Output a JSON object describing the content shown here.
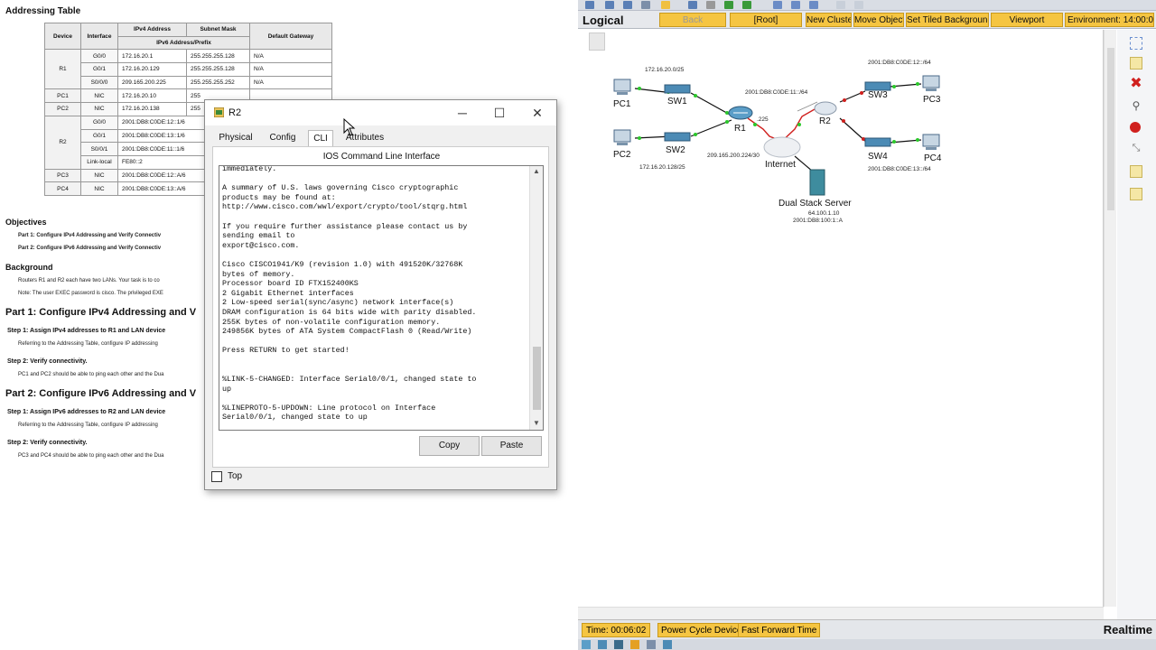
{
  "doc": {
    "title": "Addressing Table",
    "table": {
      "headers": [
        "Device",
        "Interface",
        "IPv4 Address",
        "Subnet Mask",
        "Default Gateway",
        "IPv6 Address/Prefix"
      ],
      "rows": [
        [
          "R1",
          "G0/0",
          "172.16.20.1",
          "255.255.255.128",
          "N/A"
        ],
        [
          "",
          "G0/1",
          "172.16.20.129",
          "255.255.255.128",
          "N/A"
        ],
        [
          "",
          "S0/0/0",
          "209.165.200.225",
          "255.255.255.252",
          "N/A"
        ],
        [
          "PC1",
          "NIC",
          "172.16.20.10",
          "255",
          ""
        ],
        [
          "PC2",
          "NIC",
          "172.16.20.138",
          "255",
          ""
        ],
        [
          "R2",
          "G0/0",
          "2001:DB8:C0DE:12::1/6",
          "",
          ""
        ],
        [
          "",
          "G0/1",
          "2001:DB8:C0DE:13::1/6",
          "",
          ""
        ],
        [
          "",
          "S0/0/1",
          "2001:DB8:C0DE:11::1/6",
          "",
          ""
        ],
        [
          "",
          "Link-local",
          "FE80::2",
          "",
          ""
        ],
        [
          "PC3",
          "NIC",
          "2001:DB8:C0DE:12::A/6",
          "",
          ""
        ],
        [
          "PC4",
          "NIC",
          "2001:DB8:C0DE:13::A/6",
          "",
          ""
        ]
      ]
    },
    "objectives": {
      "heading": "Objectives",
      "part1": "Part 1: Configure IPv4 Addressing and Verify Connectiv",
      "part2": "Part 2: Configure IPv6 Addressing and Verify Connectiv"
    },
    "background": {
      "heading": "Background",
      "line1": "Routers R1 and R2 each have two LANs. Your task is to co",
      "line2": "Note: The user EXEC password is cisco. The privileged EXE"
    },
    "part1": {
      "heading": "Part 1:  Configure IPv4 Addressing and V",
      "step1": "Step 1:  Assign IPv4 addresses to R1 and LAN device",
      "step1_text": "Referring to the Addressing Table, configure IP addressing",
      "step2": "Step 2:  Verify connectivity.",
      "step2_text": "PC1 and PC2 should be able to ping each other and the Dua"
    },
    "part2": {
      "heading": "Part 2:  Configure IPv6 Addressing and V",
      "step1": "Step 1:  Assign IPv6 addresses to R2 and LAN device",
      "step1_text": "Referring to the Addressing Table, configure IP addressing",
      "step2": "Step 2:  Verify connectivity.",
      "step2_text": "PC3 and PC4 should be able to ping each other and the Dua"
    }
  },
  "pt": {
    "mode": "Logical",
    "toolbar": {
      "back": "Back",
      "root": "[Root]",
      "new_cluster": "New Cluster",
      "move_object": "Move Object",
      "set_tiled_bg": "Set Tiled Background",
      "viewport": "Viewport",
      "environment": "Environment: 14:00:0"
    },
    "nodes": {
      "pc1": "PC1",
      "pc2": "PC2",
      "sw1": "SW1",
      "sw2": "SW2",
      "r1": "R1",
      "r2": "R2",
      "sw3": "SW3",
      "sw4": "SW4",
      "pc3": "PC3",
      "pc4": "PC4",
      "internet": "Internet",
      "server": "Dual Stack Server"
    },
    "addresses": {
      "lan1": "172.16.20.0/25",
      "lan2": "172.16.20.128/25",
      "wan": "209.165.200.224/30",
      "r1_if": ".225",
      "r2_wan": "2001:DB8:C0DE:11::/64",
      "lan3": "2001:DB8:C0DE:12::/64",
      "lan4": "2001:DB8:C0DE:13::/64",
      "server_v4": "64.100.1.10",
      "server_v6": "2001:DB8:100:1::A"
    },
    "status": {
      "time": "Time: 00:06:02",
      "power_cycle": "Power Cycle Devices",
      "fast_forward": "Fast Forward Time",
      "realtime": "Realtime"
    }
  },
  "dialog": {
    "title": "R2",
    "tabs": [
      "Physical",
      "Config",
      "CLI",
      "Attributes"
    ],
    "active_tab": "CLI",
    "cli_heading": "IOS Command Line Interface",
    "cli_output": "immediately.\n\nA summary of U.S. laws governing Cisco cryptographic\nproducts may be found at:\nhttp://www.cisco.com/wwl/export/crypto/tool/stqrg.html\n\nIf you require further assistance please contact us by\nsending email to\nexport@cisco.com.\n\nCisco CISCO1941/K9 (revision 1.0) with 491520K/32768K\nbytes of memory.\nProcessor board ID FTX152400KS\n2 Gigabit Ethernet interfaces\n2 Low-speed serial(sync/async) network interface(s)\nDRAM configuration is 64 bits wide with parity disabled.\n255K bytes of non-volatile configuration memory.\n249856K bytes of ATA System CompactFlash 0 (Read/Write)\n\nPress RETURN to get started!\n\n\n%LINK-5-CHANGED: Interface Serial0/0/1, changed state to\nup\n\n%LINEPROTO-5-UPDOWN: Line protocol on Interface\nSerial0/0/1, changed state to up\n",
    "copy": "Copy",
    "paste": "Paste",
    "top": "Top"
  }
}
